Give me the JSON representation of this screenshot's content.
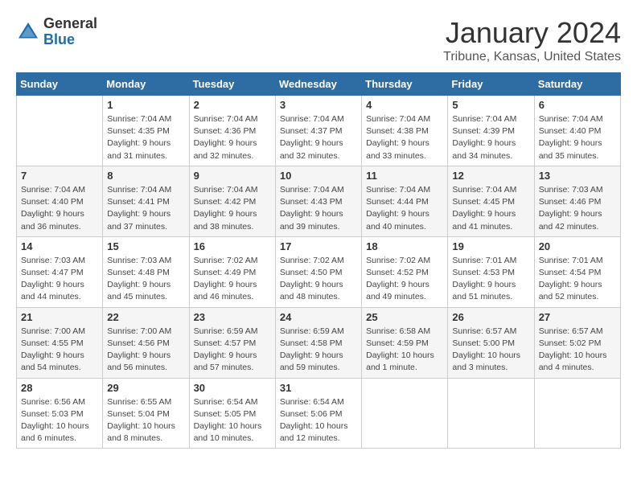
{
  "header": {
    "logo_line1": "General",
    "logo_line2": "Blue",
    "title": "January 2024",
    "subtitle": "Tribune, Kansas, United States"
  },
  "weekdays": [
    "Sunday",
    "Monday",
    "Tuesday",
    "Wednesday",
    "Thursday",
    "Friday",
    "Saturday"
  ],
  "weeks": [
    [
      {
        "day": "",
        "info": ""
      },
      {
        "day": "1",
        "info": "Sunrise: 7:04 AM\nSunset: 4:35 PM\nDaylight: 9 hours\nand 31 minutes."
      },
      {
        "day": "2",
        "info": "Sunrise: 7:04 AM\nSunset: 4:36 PM\nDaylight: 9 hours\nand 32 minutes."
      },
      {
        "day": "3",
        "info": "Sunrise: 7:04 AM\nSunset: 4:37 PM\nDaylight: 9 hours\nand 32 minutes."
      },
      {
        "day": "4",
        "info": "Sunrise: 7:04 AM\nSunset: 4:38 PM\nDaylight: 9 hours\nand 33 minutes."
      },
      {
        "day": "5",
        "info": "Sunrise: 7:04 AM\nSunset: 4:39 PM\nDaylight: 9 hours\nand 34 minutes."
      },
      {
        "day": "6",
        "info": "Sunrise: 7:04 AM\nSunset: 4:40 PM\nDaylight: 9 hours\nand 35 minutes."
      }
    ],
    [
      {
        "day": "7",
        "info": "Sunrise: 7:04 AM\nSunset: 4:40 PM\nDaylight: 9 hours\nand 36 minutes."
      },
      {
        "day": "8",
        "info": "Sunrise: 7:04 AM\nSunset: 4:41 PM\nDaylight: 9 hours\nand 37 minutes."
      },
      {
        "day": "9",
        "info": "Sunrise: 7:04 AM\nSunset: 4:42 PM\nDaylight: 9 hours\nand 38 minutes."
      },
      {
        "day": "10",
        "info": "Sunrise: 7:04 AM\nSunset: 4:43 PM\nDaylight: 9 hours\nand 39 minutes."
      },
      {
        "day": "11",
        "info": "Sunrise: 7:04 AM\nSunset: 4:44 PM\nDaylight: 9 hours\nand 40 minutes."
      },
      {
        "day": "12",
        "info": "Sunrise: 7:04 AM\nSunset: 4:45 PM\nDaylight: 9 hours\nand 41 minutes."
      },
      {
        "day": "13",
        "info": "Sunrise: 7:03 AM\nSunset: 4:46 PM\nDaylight: 9 hours\nand 42 minutes."
      }
    ],
    [
      {
        "day": "14",
        "info": "Sunrise: 7:03 AM\nSunset: 4:47 PM\nDaylight: 9 hours\nand 44 minutes."
      },
      {
        "day": "15",
        "info": "Sunrise: 7:03 AM\nSunset: 4:48 PM\nDaylight: 9 hours\nand 45 minutes."
      },
      {
        "day": "16",
        "info": "Sunrise: 7:02 AM\nSunset: 4:49 PM\nDaylight: 9 hours\nand 46 minutes."
      },
      {
        "day": "17",
        "info": "Sunrise: 7:02 AM\nSunset: 4:50 PM\nDaylight: 9 hours\nand 48 minutes."
      },
      {
        "day": "18",
        "info": "Sunrise: 7:02 AM\nSunset: 4:52 PM\nDaylight: 9 hours\nand 49 minutes."
      },
      {
        "day": "19",
        "info": "Sunrise: 7:01 AM\nSunset: 4:53 PM\nDaylight: 9 hours\nand 51 minutes."
      },
      {
        "day": "20",
        "info": "Sunrise: 7:01 AM\nSunset: 4:54 PM\nDaylight: 9 hours\nand 52 minutes."
      }
    ],
    [
      {
        "day": "21",
        "info": "Sunrise: 7:00 AM\nSunset: 4:55 PM\nDaylight: 9 hours\nand 54 minutes."
      },
      {
        "day": "22",
        "info": "Sunrise: 7:00 AM\nSunset: 4:56 PM\nDaylight: 9 hours\nand 56 minutes."
      },
      {
        "day": "23",
        "info": "Sunrise: 6:59 AM\nSunset: 4:57 PM\nDaylight: 9 hours\nand 57 minutes."
      },
      {
        "day": "24",
        "info": "Sunrise: 6:59 AM\nSunset: 4:58 PM\nDaylight: 9 hours\nand 59 minutes."
      },
      {
        "day": "25",
        "info": "Sunrise: 6:58 AM\nSunset: 4:59 PM\nDaylight: 10 hours\nand 1 minute."
      },
      {
        "day": "26",
        "info": "Sunrise: 6:57 AM\nSunset: 5:00 PM\nDaylight: 10 hours\nand 3 minutes."
      },
      {
        "day": "27",
        "info": "Sunrise: 6:57 AM\nSunset: 5:02 PM\nDaylight: 10 hours\nand 4 minutes."
      }
    ],
    [
      {
        "day": "28",
        "info": "Sunrise: 6:56 AM\nSunset: 5:03 PM\nDaylight: 10 hours\nand 6 minutes."
      },
      {
        "day": "29",
        "info": "Sunrise: 6:55 AM\nSunset: 5:04 PM\nDaylight: 10 hours\nand 8 minutes."
      },
      {
        "day": "30",
        "info": "Sunrise: 6:54 AM\nSunset: 5:05 PM\nDaylight: 10 hours\nand 10 minutes."
      },
      {
        "day": "31",
        "info": "Sunrise: 6:54 AM\nSunset: 5:06 PM\nDaylight: 10 hours\nand 12 minutes."
      },
      {
        "day": "",
        "info": ""
      },
      {
        "day": "",
        "info": ""
      },
      {
        "day": "",
        "info": ""
      }
    ]
  ]
}
